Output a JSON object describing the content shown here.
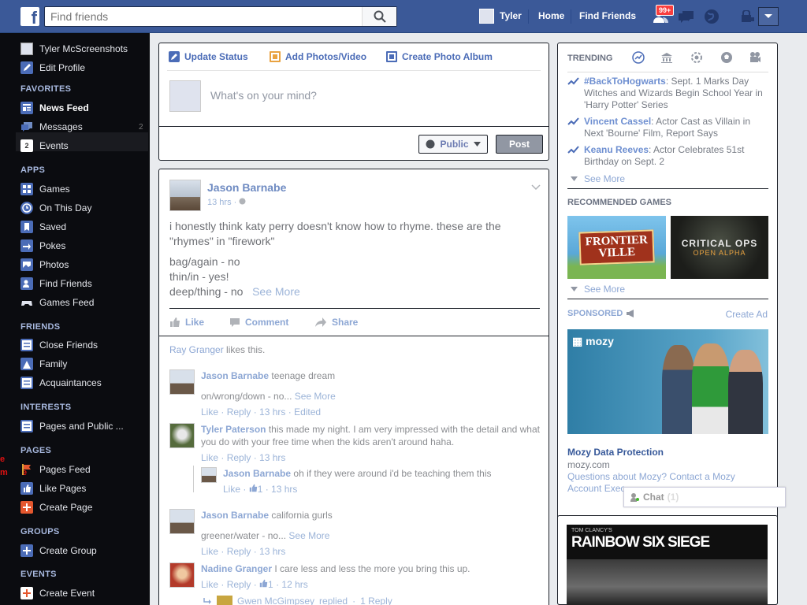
{
  "topbar": {
    "logo": "f",
    "search_placeholder": "Find friends",
    "user_name": "Tyler",
    "home": "Home",
    "find_friends": "Find Friends",
    "friend_requests_count": "99+"
  },
  "leftnav": {
    "profile_name": "Tyler McScreenshots",
    "edit_profile": "Edit Profile",
    "favorites_head": "FAVORITES",
    "news_feed": "News Feed",
    "messages": "Messages",
    "messages_count": "2",
    "events": "Events",
    "events_icon_num": "2",
    "apps_head": "APPS",
    "games": "Games",
    "on_this_day": "On This Day",
    "saved": "Saved",
    "pokes": "Pokes",
    "photos": "Photos",
    "find_friends": "Find Friends",
    "games_feed": "Games Feed",
    "friends_head": "FRIENDS",
    "close_friends": "Close Friends",
    "family": "Family",
    "acquaintances": "Acquaintances",
    "interests_head": "INTERESTS",
    "pages_and_public": "Pages and Public ...",
    "pages_head": "PAGES",
    "pages_feed": "Pages Feed",
    "like_pages": "Like Pages",
    "create_page": "Create Page",
    "groups_head": "GROUPS",
    "create_group": "Create Group",
    "events_head": "EVENTS",
    "create_event": "Create Event"
  },
  "composer": {
    "tab_status": "Update Status",
    "tab_photos": "Add Photos/Video",
    "tab_album": "Create Photo Album",
    "placeholder": "What's on your mind?",
    "privacy": "Public",
    "post_button": "Post"
  },
  "post": {
    "author": "Jason Barnabe",
    "time": "13 hrs",
    "text_line1": "i honestly think katy perry doesn't know how to rhyme. these are the",
    "text_line2": "\"rhymes\" in \"firework\"",
    "text_line3": "bag/again - no",
    "text_line4": "thin/in - yes!",
    "text_line5": "deep/thing - no",
    "see_more": "See More",
    "like": "Like",
    "comment": "Comment",
    "share": "Share",
    "liker": "Ray Granger",
    "likes_suffix": "likes this."
  },
  "comments": [
    {
      "name": "Jason Barnabe",
      "text": "teenage dream",
      "line2": "on/wrong/down - no...",
      "see_more": "See More",
      "like": "Like",
      "reply": "Reply",
      "time": "13 hrs",
      "edited": "Edited"
    },
    {
      "name": "Tyler Paterson",
      "text": "this made my night. I am very impressed with the detail and what you do with your free time when the kids aren't around haha.",
      "like": "Like",
      "reply": "Reply",
      "time": "13 hrs"
    },
    {
      "name": "Jason Barnabe",
      "text": "oh if they were around i'd be teaching them this",
      "like": "Like",
      "likes": "1",
      "time": "13 hrs"
    },
    {
      "name": "Jason Barnabe",
      "text": "california gurls",
      "line2": "greener/water - no...",
      "see_more": "See More",
      "like": "Like",
      "reply": "Reply",
      "time": "13 hrs"
    },
    {
      "name": "Nadine Granger",
      "text": "I care less and less the more you bring this up.",
      "like": "Like",
      "reply": "Reply",
      "likes": "1",
      "time": "12 hrs"
    },
    {
      "name": "Gwen McGimpsey",
      "text": "replied",
      "replies": "1 Reply"
    }
  ],
  "right": {
    "trending_head": "TRENDING",
    "trends": [
      {
        "topic": "#BackToHogwarts",
        "text": ": Sept. 1 Marks Day Witches and Wizards Begin School Year in 'Harry Potter' Series"
      },
      {
        "topic": "Vincent Cassel",
        "text": ": Actor Cast as Villain in Next 'Bourne' Film, Report Says"
      },
      {
        "topic": "Keanu Reeves",
        "text": ": Actor Celebrates 51st Birthday on Sept. 2"
      }
    ],
    "see_more": "See More",
    "games_head": "RECOMMENDED GAMES",
    "game1_title_a": "FRONTIER",
    "game1_title_b": "VILLE",
    "game2_title": "CRITICAL OPS",
    "game2_sub": "OPEN ALPHA",
    "see_more2": "See More",
    "sponsored": "SPONSORED",
    "create_ad": "Create Ad",
    "ad_logo": "mozy",
    "ad_title": "Mozy Data Protection",
    "ad_url": "mozy.com",
    "ad_text": "Questions about Mozy? Contact a Mozy Account Exec",
    "chat": "Chat",
    "chat_count": "(1)",
    "ad2_brand": "TOM CLANCY'S",
    "ad2_title": "RAINBOW SIX SIEGE"
  },
  "colors": {
    "brand": "#3b5998",
    "link": "#365899",
    "leftnav_bg": "#0b0c10"
  }
}
